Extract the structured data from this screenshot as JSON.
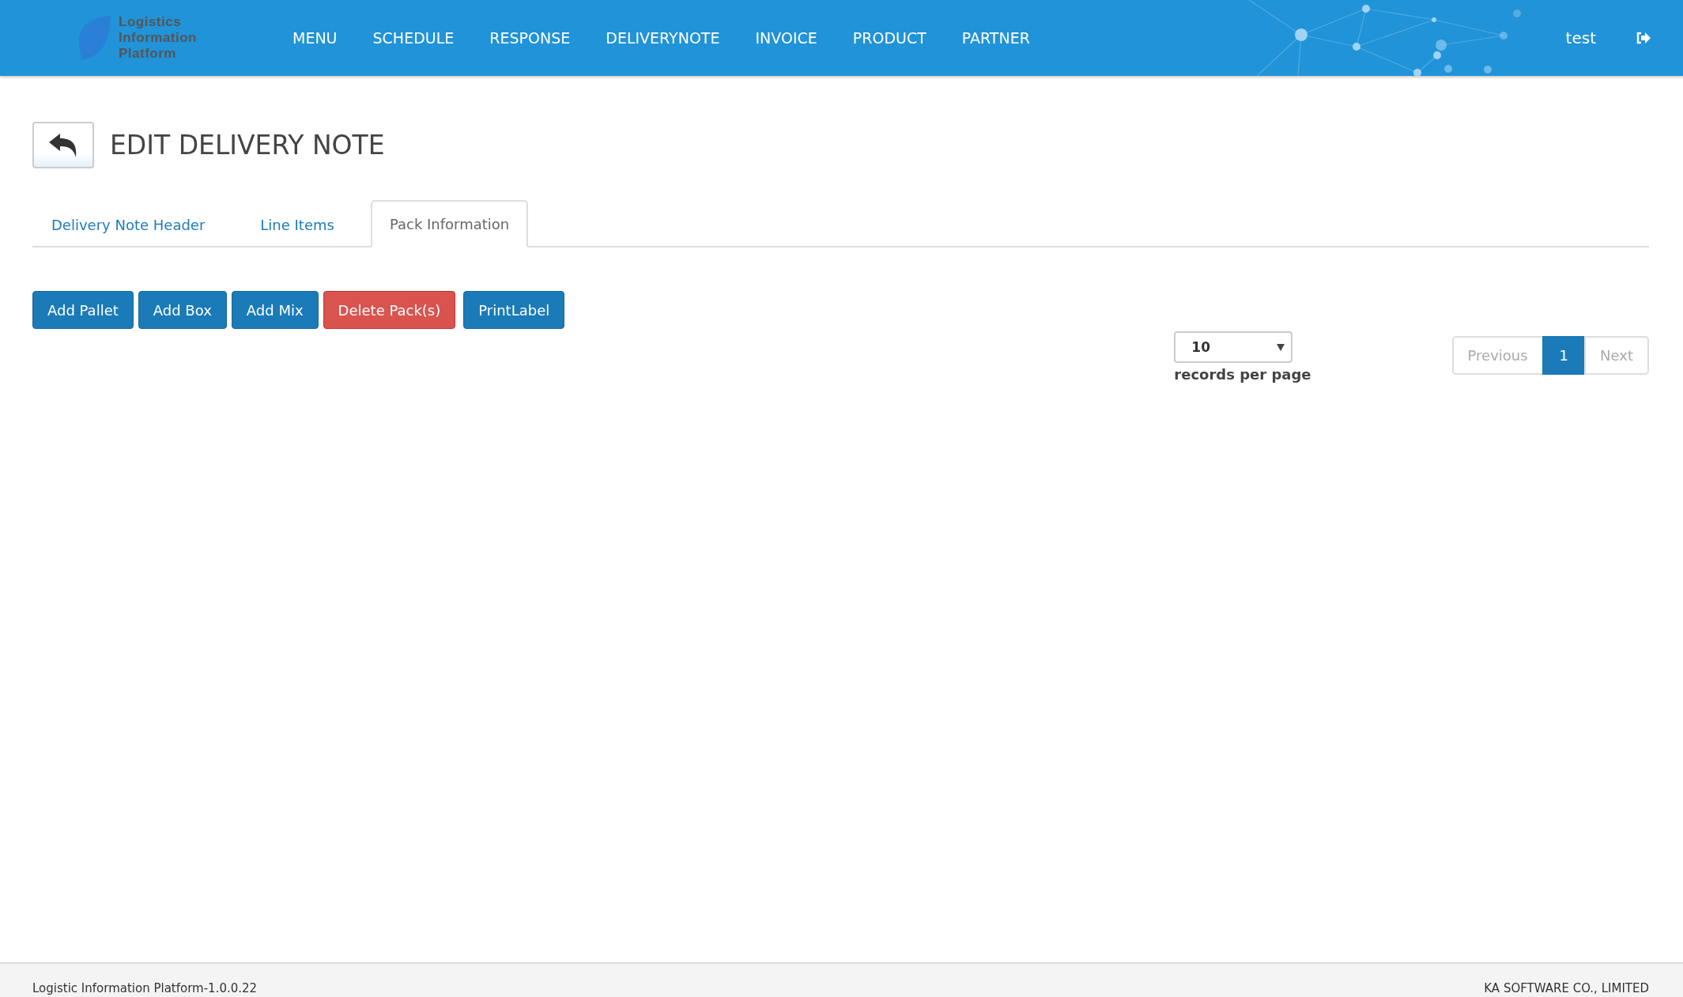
{
  "logo": {
    "lines": [
      "Logistics",
      "Information",
      "Platform"
    ]
  },
  "nav": [
    {
      "label": "MENU"
    },
    {
      "label": "SCHEDULE"
    },
    {
      "label": "RESPONSE"
    },
    {
      "label": "DELIVERYNOTE"
    },
    {
      "label": "INVOICE"
    },
    {
      "label": "PRODUCT"
    },
    {
      "label": "PARTNER"
    }
  ],
  "user": "test",
  "page_title": "EDIT DELIVERY NOTE",
  "tabs": [
    {
      "label": "Delivery Note Header",
      "selected": false
    },
    {
      "label": "Line Items",
      "selected": false
    },
    {
      "label": "Pack Information",
      "selected": true
    }
  ],
  "buttons": [
    {
      "label": "Add Pallet",
      "kind": "primary"
    },
    {
      "label": "Add Box",
      "kind": "primary"
    },
    {
      "label": "Add Mix",
      "kind": "primary"
    },
    {
      "label": "Delete Pack(s)",
      "kind": "danger"
    },
    {
      "label": "PrintLabel",
      "kind": "primary"
    }
  ],
  "page_size": {
    "value": "10",
    "label": "records per page"
  },
  "pagination": [
    {
      "label": "Previous",
      "selected": false,
      "disabled": true
    },
    {
      "label": "1",
      "selected": true,
      "disabled": false
    },
    {
      "label": "Next",
      "selected": false,
      "disabled": true
    }
  ],
  "footer": {
    "left": "Logistic Information Platform-1.0.0.22",
    "right": "KA SOFTWARE CO., LIMITED"
  }
}
